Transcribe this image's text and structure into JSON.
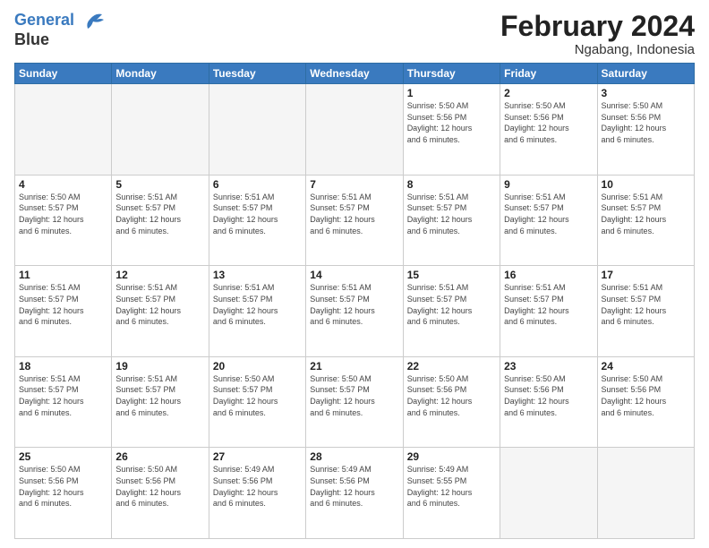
{
  "logo": {
    "line1": "General",
    "line2": "Blue"
  },
  "title": "February 2024",
  "subtitle": "Ngabang, Indonesia",
  "weekdays": [
    "Sunday",
    "Monday",
    "Tuesday",
    "Wednesday",
    "Thursday",
    "Friday",
    "Saturday"
  ],
  "weeks": [
    [
      {
        "day": "",
        "info": ""
      },
      {
        "day": "",
        "info": ""
      },
      {
        "day": "",
        "info": ""
      },
      {
        "day": "",
        "info": ""
      },
      {
        "day": "1",
        "info": "Sunrise: 5:50 AM\nSunset: 5:56 PM\nDaylight: 12 hours\nand 6 minutes."
      },
      {
        "day": "2",
        "info": "Sunrise: 5:50 AM\nSunset: 5:56 PM\nDaylight: 12 hours\nand 6 minutes."
      },
      {
        "day": "3",
        "info": "Sunrise: 5:50 AM\nSunset: 5:56 PM\nDaylight: 12 hours\nand 6 minutes."
      }
    ],
    [
      {
        "day": "4",
        "info": "Sunrise: 5:50 AM\nSunset: 5:57 PM\nDaylight: 12 hours\nand 6 minutes."
      },
      {
        "day": "5",
        "info": "Sunrise: 5:51 AM\nSunset: 5:57 PM\nDaylight: 12 hours\nand 6 minutes."
      },
      {
        "day": "6",
        "info": "Sunrise: 5:51 AM\nSunset: 5:57 PM\nDaylight: 12 hours\nand 6 minutes."
      },
      {
        "day": "7",
        "info": "Sunrise: 5:51 AM\nSunset: 5:57 PM\nDaylight: 12 hours\nand 6 minutes."
      },
      {
        "day": "8",
        "info": "Sunrise: 5:51 AM\nSunset: 5:57 PM\nDaylight: 12 hours\nand 6 minutes."
      },
      {
        "day": "9",
        "info": "Sunrise: 5:51 AM\nSunset: 5:57 PM\nDaylight: 12 hours\nand 6 minutes."
      },
      {
        "day": "10",
        "info": "Sunrise: 5:51 AM\nSunset: 5:57 PM\nDaylight: 12 hours\nand 6 minutes."
      }
    ],
    [
      {
        "day": "11",
        "info": "Sunrise: 5:51 AM\nSunset: 5:57 PM\nDaylight: 12 hours\nand 6 minutes."
      },
      {
        "day": "12",
        "info": "Sunrise: 5:51 AM\nSunset: 5:57 PM\nDaylight: 12 hours\nand 6 minutes."
      },
      {
        "day": "13",
        "info": "Sunrise: 5:51 AM\nSunset: 5:57 PM\nDaylight: 12 hours\nand 6 minutes."
      },
      {
        "day": "14",
        "info": "Sunrise: 5:51 AM\nSunset: 5:57 PM\nDaylight: 12 hours\nand 6 minutes."
      },
      {
        "day": "15",
        "info": "Sunrise: 5:51 AM\nSunset: 5:57 PM\nDaylight: 12 hours\nand 6 minutes."
      },
      {
        "day": "16",
        "info": "Sunrise: 5:51 AM\nSunset: 5:57 PM\nDaylight: 12 hours\nand 6 minutes."
      },
      {
        "day": "17",
        "info": "Sunrise: 5:51 AM\nSunset: 5:57 PM\nDaylight: 12 hours\nand 6 minutes."
      }
    ],
    [
      {
        "day": "18",
        "info": "Sunrise: 5:51 AM\nSunset: 5:57 PM\nDaylight: 12 hours\nand 6 minutes."
      },
      {
        "day": "19",
        "info": "Sunrise: 5:51 AM\nSunset: 5:57 PM\nDaylight: 12 hours\nand 6 minutes."
      },
      {
        "day": "20",
        "info": "Sunrise: 5:50 AM\nSunset: 5:57 PM\nDaylight: 12 hours\nand 6 minutes."
      },
      {
        "day": "21",
        "info": "Sunrise: 5:50 AM\nSunset: 5:57 PM\nDaylight: 12 hours\nand 6 minutes."
      },
      {
        "day": "22",
        "info": "Sunrise: 5:50 AM\nSunset: 5:56 PM\nDaylight: 12 hours\nand 6 minutes."
      },
      {
        "day": "23",
        "info": "Sunrise: 5:50 AM\nSunset: 5:56 PM\nDaylight: 12 hours\nand 6 minutes."
      },
      {
        "day": "24",
        "info": "Sunrise: 5:50 AM\nSunset: 5:56 PM\nDaylight: 12 hours\nand 6 minutes."
      }
    ],
    [
      {
        "day": "25",
        "info": "Sunrise: 5:50 AM\nSunset: 5:56 PM\nDaylight: 12 hours\nand 6 minutes."
      },
      {
        "day": "26",
        "info": "Sunrise: 5:50 AM\nSunset: 5:56 PM\nDaylight: 12 hours\nand 6 minutes."
      },
      {
        "day": "27",
        "info": "Sunrise: 5:49 AM\nSunset: 5:56 PM\nDaylight: 12 hours\nand 6 minutes."
      },
      {
        "day": "28",
        "info": "Sunrise: 5:49 AM\nSunset: 5:56 PM\nDaylight: 12 hours\nand 6 minutes."
      },
      {
        "day": "29",
        "info": "Sunrise: 5:49 AM\nSunset: 5:55 PM\nDaylight: 12 hours\nand 6 minutes."
      },
      {
        "day": "",
        "info": ""
      },
      {
        "day": "",
        "info": ""
      }
    ]
  ]
}
